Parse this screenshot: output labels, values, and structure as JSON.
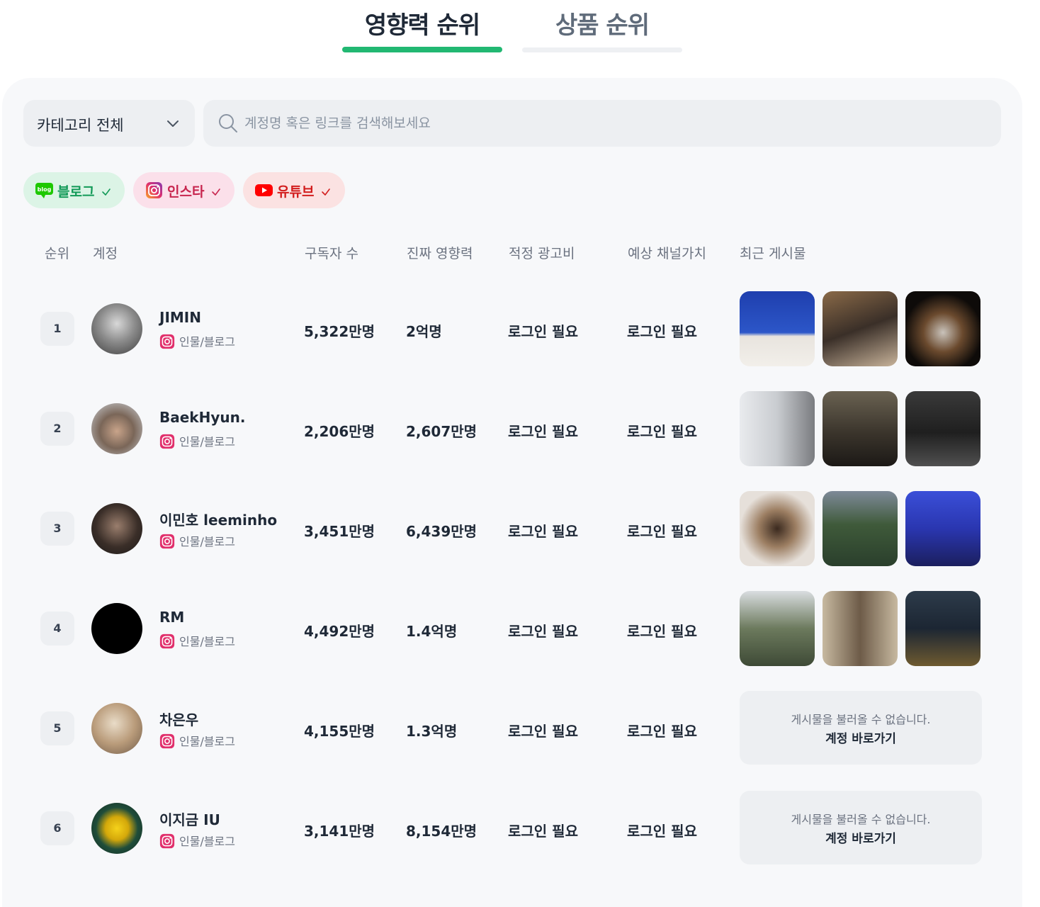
{
  "tabs": [
    {
      "label": "영향력 순위",
      "active": true
    },
    {
      "label": "상품 순위",
      "active": false
    }
  ],
  "filters": {
    "category_label": "카테고리 전체",
    "search_placeholder": "계정명 혹은 링크를 검색해보세요",
    "search_value": ""
  },
  "platform_chips": [
    {
      "icon": "naver-blog-icon",
      "label": "블로그",
      "color": "#139a58"
    },
    {
      "icon": "instagram-icon",
      "label": "인스타",
      "color": "#c7254e"
    },
    {
      "icon": "youtube-icon",
      "label": "유튜브",
      "color": "#d21d1d"
    }
  ],
  "table": {
    "headers": {
      "rank": "순위",
      "account": "계정",
      "subscribers": "구독자 수",
      "real_influence": "진짜 영향력",
      "ad_fee": "적정 광고비",
      "channel_value": "예상 채널가치",
      "recent_posts": "최근 게시물"
    },
    "rows": [
      {
        "rank": "1",
        "name": "JIMIN",
        "platform_icon": "instagram-icon",
        "category": "인물/블로그",
        "subscribers": "5,322만명",
        "real_influence": "2억명",
        "ad_fee": "로그인 필요",
        "channel_value": "로그인 필요",
        "posts_available": true,
        "no_posts_message": "",
        "go_account": ""
      },
      {
        "rank": "2",
        "name": "BaekHyun.",
        "platform_icon": "instagram-icon",
        "category": "인물/블로그",
        "subscribers": "2,206만명",
        "real_influence": "2,607만명",
        "ad_fee": "로그인 필요",
        "channel_value": "로그인 필요",
        "posts_available": true,
        "no_posts_message": "",
        "go_account": ""
      },
      {
        "rank": "3",
        "name": "이민호 leeminho",
        "platform_icon": "instagram-icon",
        "category": "인물/블로그",
        "subscribers": "3,451만명",
        "real_influence": "6,439만명",
        "ad_fee": "로그인 필요",
        "channel_value": "로그인 필요",
        "posts_available": true,
        "no_posts_message": "",
        "go_account": ""
      },
      {
        "rank": "4",
        "name": "RM",
        "platform_icon": "instagram-icon",
        "category": "인물/블로그",
        "subscribers": "4,492만명",
        "real_influence": "1.4억명",
        "ad_fee": "로그인 필요",
        "channel_value": "로그인 필요",
        "posts_available": true,
        "no_posts_message": "",
        "go_account": ""
      },
      {
        "rank": "5",
        "name": "차은우",
        "platform_icon": "instagram-icon",
        "category": "인물/블로그",
        "subscribers": "4,155만명",
        "real_influence": "1.3억명",
        "ad_fee": "로그인 필요",
        "channel_value": "로그인 필요",
        "posts_available": false,
        "no_posts_message": "게시물을 불러올 수 없습니다.",
        "go_account": "계정 바로가기"
      },
      {
        "rank": "6",
        "name": "이지금 IU",
        "platform_icon": "instagram-icon",
        "category": "인물/블로그",
        "subscribers": "3,141만명",
        "real_influence": "8,154만명",
        "ad_fee": "로그인 필요",
        "channel_value": "로그인 필요",
        "posts_available": false,
        "no_posts_message": "게시물을 불러올 수 없습니다.",
        "go_account": "계정 바로가기"
      }
    ]
  },
  "colors": {
    "accent_green": "#21b872",
    "panel_bg": "#f7f8fa",
    "field_bg": "#edeff2"
  }
}
